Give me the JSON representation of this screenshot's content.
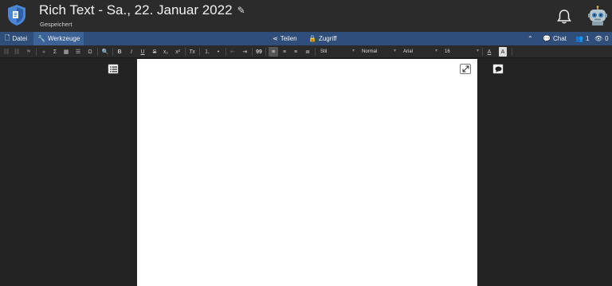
{
  "header": {
    "title": "Rich Text - Sa., 22. Januar 2022",
    "status": "Gespeichert",
    "logo_icon": "shield-logo",
    "edit_icon": "pencil-icon",
    "notification_icon": "bell-icon",
    "avatar_icon": "robot-avatar"
  },
  "menubar": {
    "file": "Datei",
    "tools": "Werkzeuge",
    "share": "Teilen",
    "access": "Zugriff",
    "chat": "Chat",
    "users_count": "1",
    "viewers_count": "0"
  },
  "toolbar": {
    "bold": "B",
    "italic": "I",
    "underline": "U",
    "strike": "S",
    "subscript": "x₂",
    "superscript": "x²",
    "clear_format": "Tx",
    "quote": "99",
    "omega": "Ω",
    "sigma": "Σ",
    "style_select": "Stil",
    "format_select": "Normal",
    "font_select": "Arial",
    "size_select": "16",
    "font_color": "A",
    "bg_color": "A"
  },
  "colors": {
    "topbar": "#2b2b2b",
    "menubar": "#2f4e7a",
    "menubar_active": "#3d6296",
    "panel": "#232323",
    "page": "#ffffff"
  }
}
